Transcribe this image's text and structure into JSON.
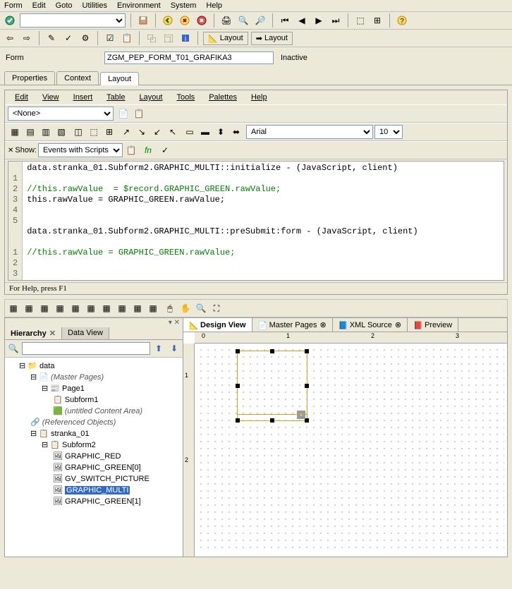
{
  "main_menu": [
    "Form",
    "Edit",
    "Goto",
    "Utilities",
    "Environment",
    "System",
    "Help"
  ],
  "form_label": "Form",
  "form_name": "ZGM_PEP_FORM_T01_GRAFIKA3",
  "form_status": "Inactive",
  "main_tabs": [
    "Properties",
    "Context",
    "Layout"
  ],
  "main_tab_active": 2,
  "layout_btn1": "Layout",
  "layout_btn2": "Layout",
  "designer_menu": [
    "Edit",
    "View",
    "Insert",
    "Table",
    "Layout",
    "Tools",
    "Palettes",
    "Help"
  ],
  "script_dropdown": "<None>",
  "show_label": "Show:",
  "show_value": "Events with Scripts",
  "font_name": "Arial",
  "font_size": "10",
  "script1_gutter": [
    "1",
    "2",
    "3",
    "4",
    "5"
  ],
  "script1_lines": [
    "data.stranka_01.Subform2.GRAPHIC_MULTI::initialize - (JavaScript, client)",
    "",
    "//this.rawValue  = $record.GRAPHIC_GREEN.rawValue;",
    "this.rawValue = GRAPHIC_GREEN.rawValue;",
    ""
  ],
  "script2_gutter": [
    "1",
    "2",
    "3"
  ],
  "script2_header": "data.stranka_01.Subform2.GRAPHIC_MULTI::preSubmit:form - (JavaScript, client)",
  "script2_comment": "//this.rawValue = GRAPHIC_GREEN.rawValue;",
  "status_text": "For Help, press F1",
  "hierarchy_tab": "Hierarchy",
  "dataview_tab": "Data View",
  "tree": {
    "root": "data",
    "master_pages": "(Master Pages)",
    "page1": "Page1",
    "subform1": "Subform1",
    "untitled": "(untitled Content Area)",
    "referenced": "(Referenced Objects)",
    "stranka": "stranka_01",
    "subform2": "Subform2",
    "graphic_red": "GRAPHIC_RED",
    "graphic_green0": "GRAPHIC_GREEN[0]",
    "gv_switch": "GV_SWITCH_PICTURE",
    "graphic_multi": "GRAPHIC_MULTI",
    "graphic_green1": "GRAPHIC_GREEN[1]"
  },
  "design_tabs": [
    "Design View",
    "Master Pages",
    "XML Source",
    "Preview"
  ],
  "design_tab_active": 0,
  "ruler_marks": [
    "0",
    "1",
    "2",
    "3"
  ],
  "ruler_v_marks": [
    "1",
    "2"
  ]
}
